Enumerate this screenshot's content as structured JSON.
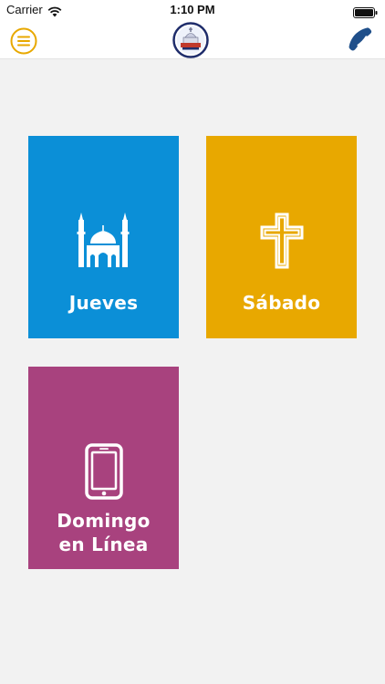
{
  "status_bar": {
    "carrier": "Carrier",
    "time": "1:10 PM"
  },
  "nav": {
    "menu_icon": "menu-icon",
    "logo_icon": "church-logo-icon",
    "phone_icon": "phone-icon"
  },
  "tiles": [
    {
      "label": "Jueves",
      "icon": "mosque-icon",
      "color": "#0b8fd7"
    },
    {
      "label": "Sábado",
      "icon": "cross-icon",
      "color": "#e8a800"
    },
    {
      "label": "Domingo\nen Línea",
      "icon": "smartphone-icon",
      "color": "#a8427e"
    }
  ],
  "colors": {
    "accent_gold": "#e8a800",
    "phone_blue": "#1f4f8a",
    "background": "#f2f2f2"
  }
}
